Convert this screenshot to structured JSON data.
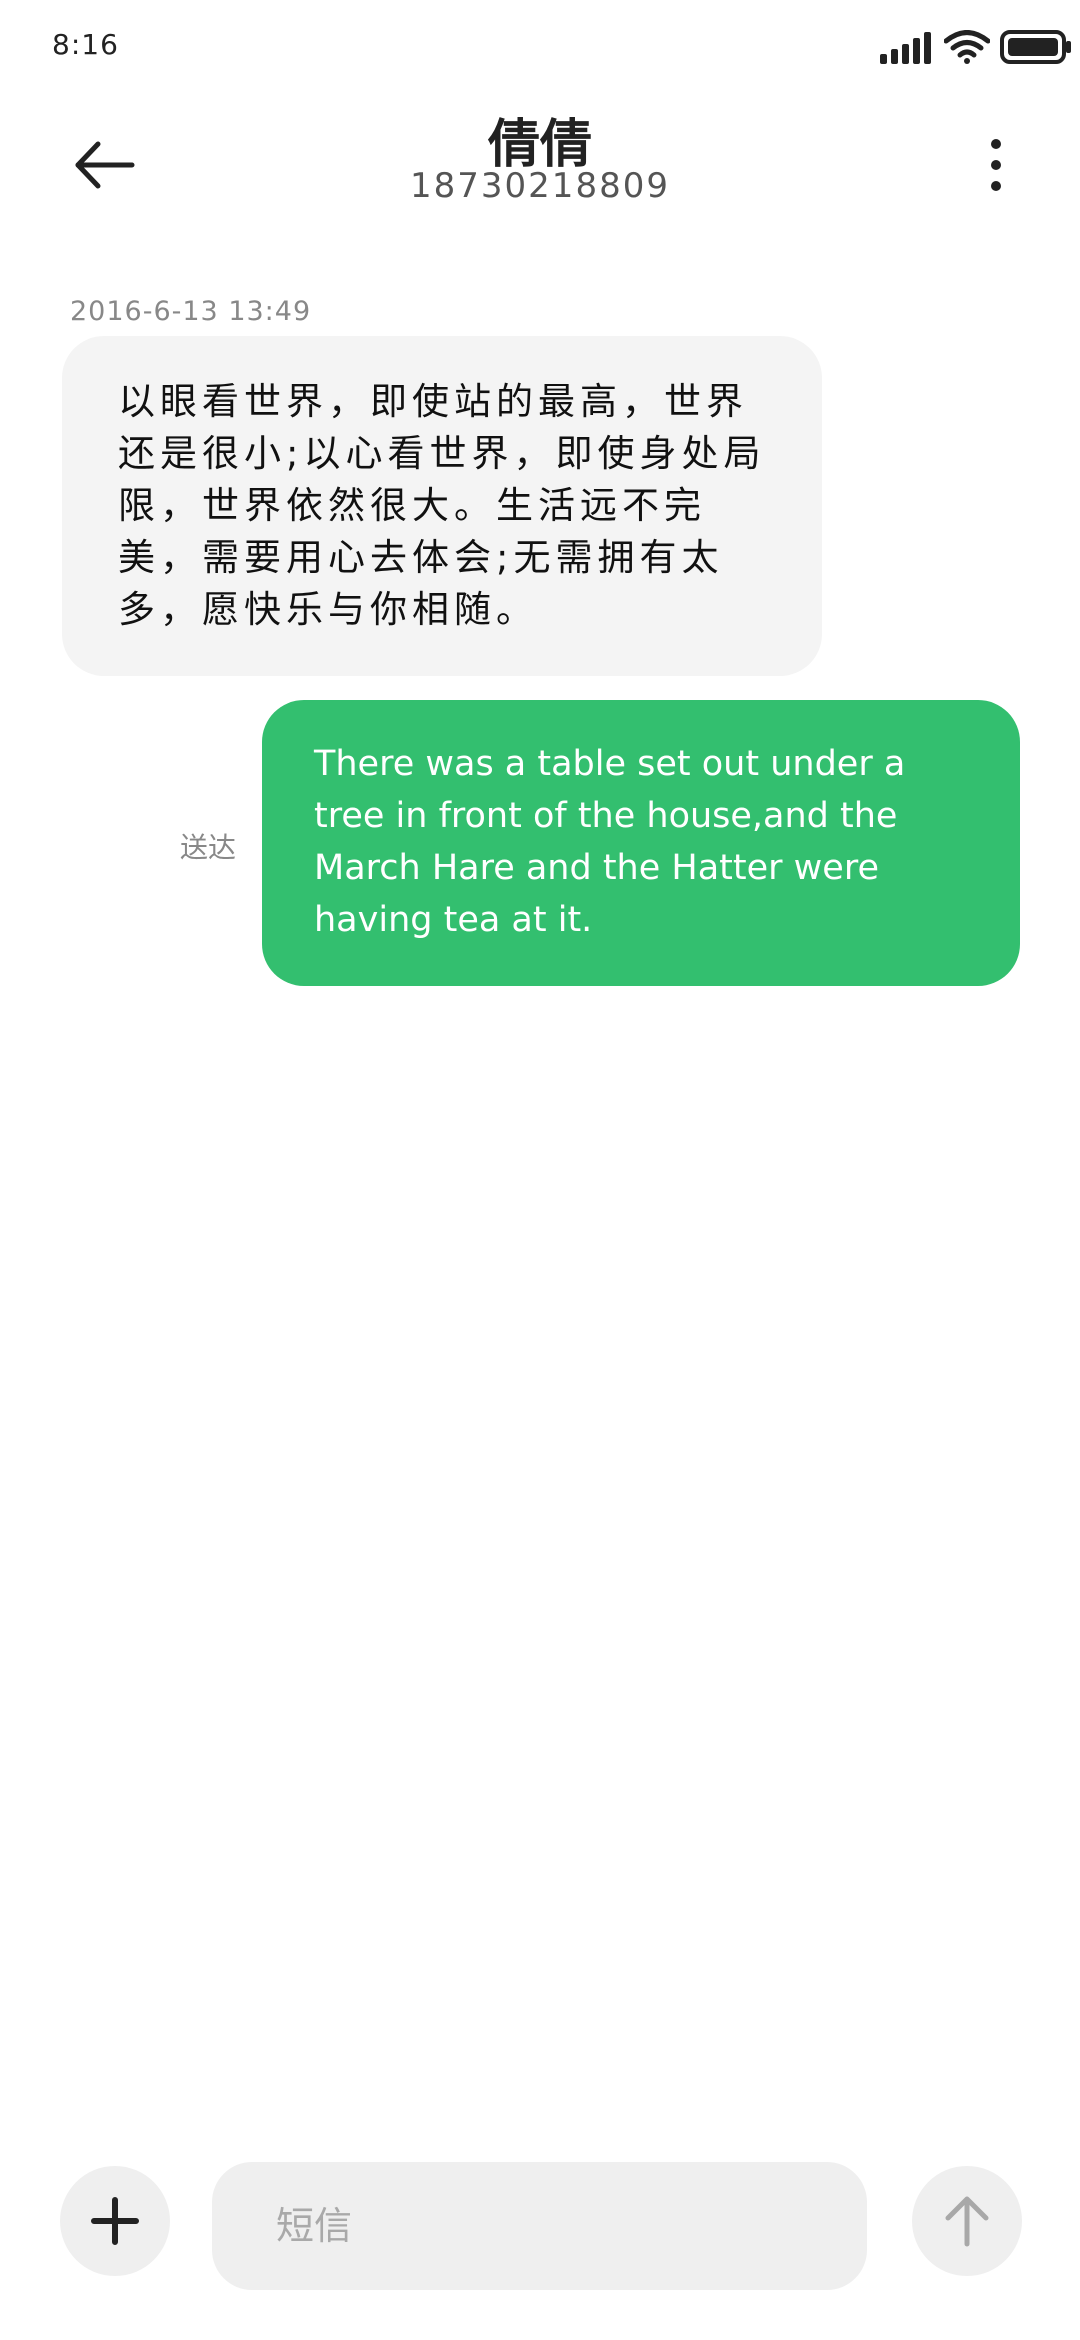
{
  "status_bar": {
    "time": "8:16",
    "icons": [
      "signal-icon",
      "wifi-icon",
      "battery-icon"
    ]
  },
  "header": {
    "back_icon": "back-arrow-icon",
    "contact_name": "倩倩",
    "contact_number": "18730218809",
    "more_icon": "more-vertical-icon"
  },
  "conversation": {
    "timestamp": "2016-6-13 13:49",
    "incoming_message": {
      "text": "以眼看世界，即使站的最高，世界还是很小;以心看世界，即使身处局限，世界依然很大。生活远不完美，需要用心去体会;无需拥有太多，愿快乐与你相随。"
    },
    "outgoing_message": {
      "text": "There was a table set out under a tree in front of the house,and the March Hare and the Hatter were having tea at it.",
      "status": "送达"
    }
  },
  "compose": {
    "attach_icon": "plus-icon",
    "placeholder": "短信",
    "value": "",
    "send_icon": "send-arrow-icon"
  },
  "colors": {
    "outgoing_bubble": "#33bf6f",
    "incoming_bubble": "#f4f4f4",
    "compose_background": "#efefef"
  }
}
